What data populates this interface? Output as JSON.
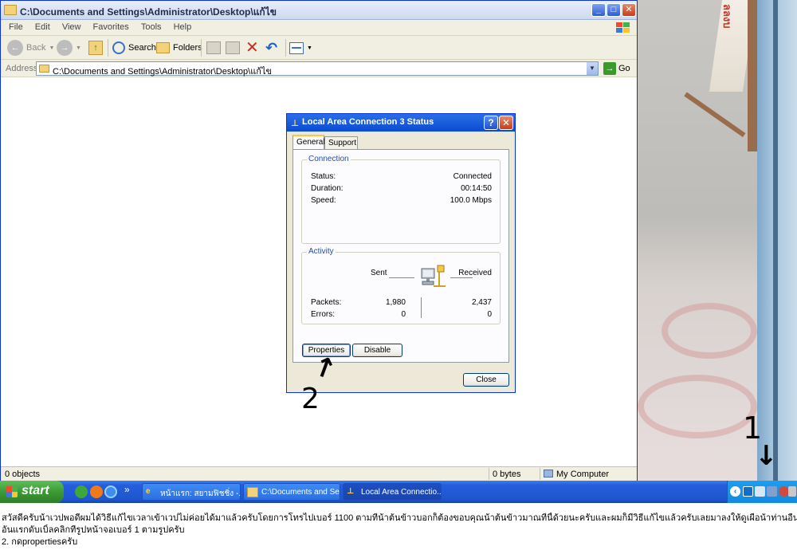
{
  "explorer": {
    "title": "C:\\Documents and Settings\\Administrator\\Desktop\\แก้ไข",
    "menu": [
      "File",
      "Edit",
      "View",
      "Favorites",
      "Tools",
      "Help"
    ],
    "toolbar": {
      "back": "Back",
      "search": "Search",
      "folders": "Folders"
    },
    "address": {
      "label": "Address",
      "value": "C:\\Documents and Settings\\Administrator\\Desktop\\แก้ไข",
      "go": "Go"
    },
    "status": {
      "objects": "0 objects",
      "size": "0 bytes",
      "location": "My Computer"
    }
  },
  "dialog": {
    "title": "Local Area Connection 3 Status",
    "tabs": [
      "General",
      "Support"
    ],
    "connection": {
      "label": "Connection",
      "status_label": "Status:",
      "status": "Connected",
      "duration_label": "Duration:",
      "duration": "00:14:50",
      "speed_label": "Speed:",
      "speed": "100.0 Mbps"
    },
    "activity": {
      "label": "Activity",
      "sent": "Sent",
      "received": "Received",
      "packets_label": "Packets:",
      "packets_sent": "1,980",
      "packets_received": "2,437",
      "errors_label": "Errors:",
      "errors_sent": "0",
      "errors_received": "0"
    },
    "buttons": {
      "properties": "Properties",
      "disable": "Disable",
      "close": "Close"
    }
  },
  "annotations": {
    "arrow_to_properties": "↑",
    "label_2": "2",
    "label_1": "1",
    "arrow_to_tray": "↓"
  },
  "photo": {
    "sign_text": "ลลงบ"
  },
  "taskbar": {
    "start": "start",
    "tasks": [
      "หน้าแรก: สยามฟิชชิ่ง -...",
      "C:\\Documents and Se...",
      "Local Area Connectio..."
    ],
    "more": "»"
  },
  "caption": {
    "line1": "สวัสดีครับน้าเวปพอดีผมได้วิธีแก้ไขเวลาเข้าเวปไม่ค่อยได้มาแล้วครับโดยการโทรไปเบอร์ 1100 ตามที่น้าต้นข้าวบอกก็ต้องขอบคุณน้าต้นข้าวมาณที่นี้ด้วยนะครับและผมก็มีวิธีแก้ไขแล้วครับเลยมาลงให้ดูเผื่อน้าท่านอื่นๆครับ",
    "line2": "อันแรกดับเบิ้ลคลิกที่รูปหน้าจอเบอร์ 1 ตามรูปครับ",
    "line3": "2. กดpropertiesครับ"
  },
  "colors": {
    "xp_blue": "#0a4bd1",
    "taskbar_blue": "#245edb",
    "start_green": "#3b9a34",
    "dialog_face": "#ece9d8"
  }
}
